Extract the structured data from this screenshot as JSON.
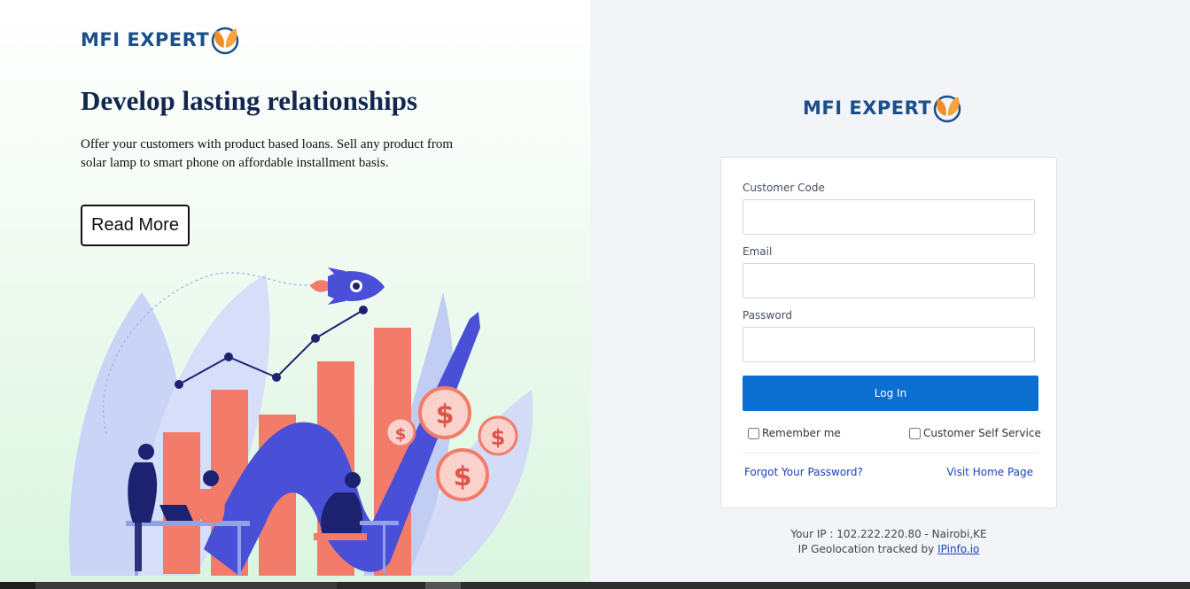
{
  "brand": {
    "logo_text": "MFI EXPERT",
    "primary_color": "#1a4f8a",
    "accent_color": "#f28c28"
  },
  "hero": {
    "headline": "Develop lasting relationships",
    "subtext": "Offer your customers with product based loans. Sell any product from solar lamp to smart phone on affordable installment basis.",
    "read_more_label": "Read More"
  },
  "login": {
    "customer_code_label": "Customer Code",
    "customer_code_value": "",
    "email_label": "Email",
    "email_value": "",
    "password_label": "Password",
    "password_value": "",
    "login_button": "Log In",
    "remember_me_label": "Remember me",
    "self_service_label": "Customer Self Service",
    "forgot_password_link": "Forgot Your Password?",
    "home_page_link": "Visit Home Page",
    "button_color": "#0a6fd1"
  },
  "ip_info": {
    "ip_line": "Your IP : 102.222.220.80 - Nairobi,KE",
    "geo_prefix": "IP Geolocation tracked by ",
    "geo_link": "IPinfo.io"
  }
}
